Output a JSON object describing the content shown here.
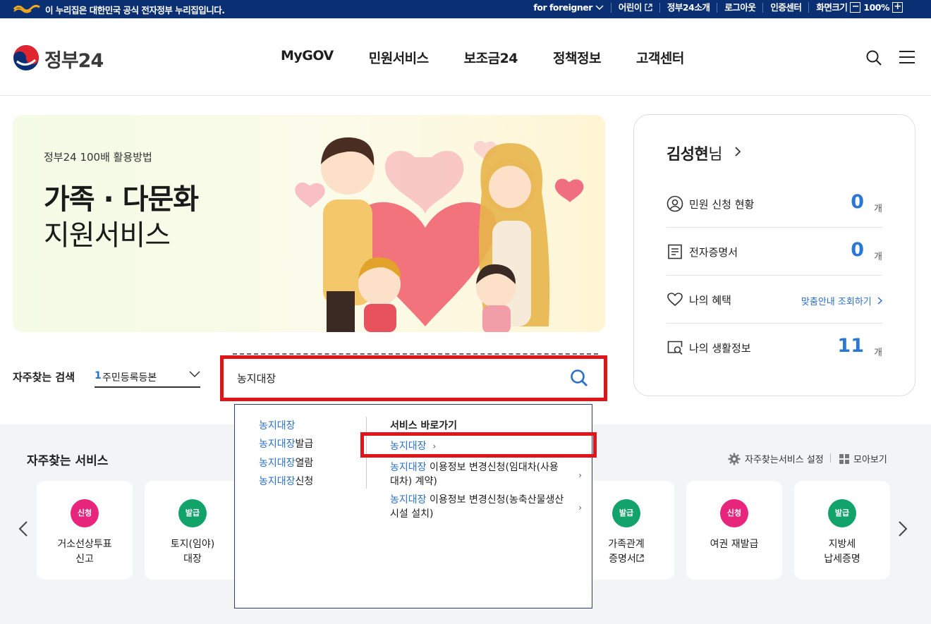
{
  "topbar": {
    "notice": "이 누리집은 대한민국 공식 전자정부 누리집입니다.",
    "links": [
      "for foreigner",
      "어린이",
      "정부24소개",
      "로그아웃",
      "인증센터"
    ],
    "font_size_label": "화면크기",
    "zoom": "100%",
    "zoom_minus": "−",
    "zoom_plus": "+"
  },
  "header": {
    "logo": "정부24",
    "nav": [
      "MyGOV",
      "민원서비스",
      "보조금24",
      "정책정보",
      "고객센터"
    ]
  },
  "banner": {
    "subtitle": "정부24 100배 활용방법",
    "title_bold": "가족 · 다문화",
    "title_light": "지원서비스"
  },
  "profile": {
    "name": "김성현",
    "honorific": "님",
    "rows": [
      {
        "label": "민원 신청 현황",
        "count": "0",
        "unit": "개",
        "icon": "user-circle-icon"
      },
      {
        "label": "전자증명서",
        "count": "0",
        "unit": "개",
        "icon": "document-icon"
      },
      {
        "label": "나의 혜택",
        "link": "맞춤안내 조회하기",
        "icon": "heart-icon"
      },
      {
        "label": "나의 생활정보",
        "count": "11",
        "unit": "개",
        "icon": "search-window-icon"
      }
    ]
  },
  "frequent_search": {
    "label": "자주찾는 검색",
    "rank": "1",
    "selected": "주민등록등본"
  },
  "search": {
    "value": "농지대장"
  },
  "autocomplete": {
    "suggestions": [
      {
        "hl": "농지대장",
        "rest": ""
      },
      {
        "hl": "농지대장",
        "rest": "발급"
      },
      {
        "hl": "농지대장",
        "rest": "열람"
      },
      {
        "hl": "농지대장",
        "rest": "신청"
      }
    ],
    "services_title": "서비스 바로가기",
    "services": [
      {
        "hl": "농지대장",
        "rest": ""
      },
      {
        "hl": "농지대장",
        "rest": " 이용정보 변경신청(임대차(사용대차) 계약)"
      },
      {
        "hl": "농지대장",
        "rest": " 이용정보 변경신청(농축산물생산시설 설치)"
      }
    ]
  },
  "frequent_services": {
    "title": "자주찾는 서비스",
    "settings_label": "자주찾는서비스 설정",
    "collect_label": "모아보기",
    "cards": [
      {
        "badge": "신청",
        "color": "#e7257d",
        "line1": "거소선상투표",
        "line2": "신고"
      },
      {
        "badge": "발급",
        "color": "#12a36a",
        "line1": "토지(임야)",
        "line2": "대장"
      },
      {
        "badge": "발급",
        "color": "#12a36a",
        "line1": "가족관계",
        "line2": "증명서"
      },
      {
        "badge": "신청",
        "color": "#e7257d",
        "line1": "여권 재발급",
        "line2": ""
      },
      {
        "badge": "발급",
        "color": "#12a36a",
        "line1": "지방세",
        "line2": "납세증명"
      }
    ]
  }
}
